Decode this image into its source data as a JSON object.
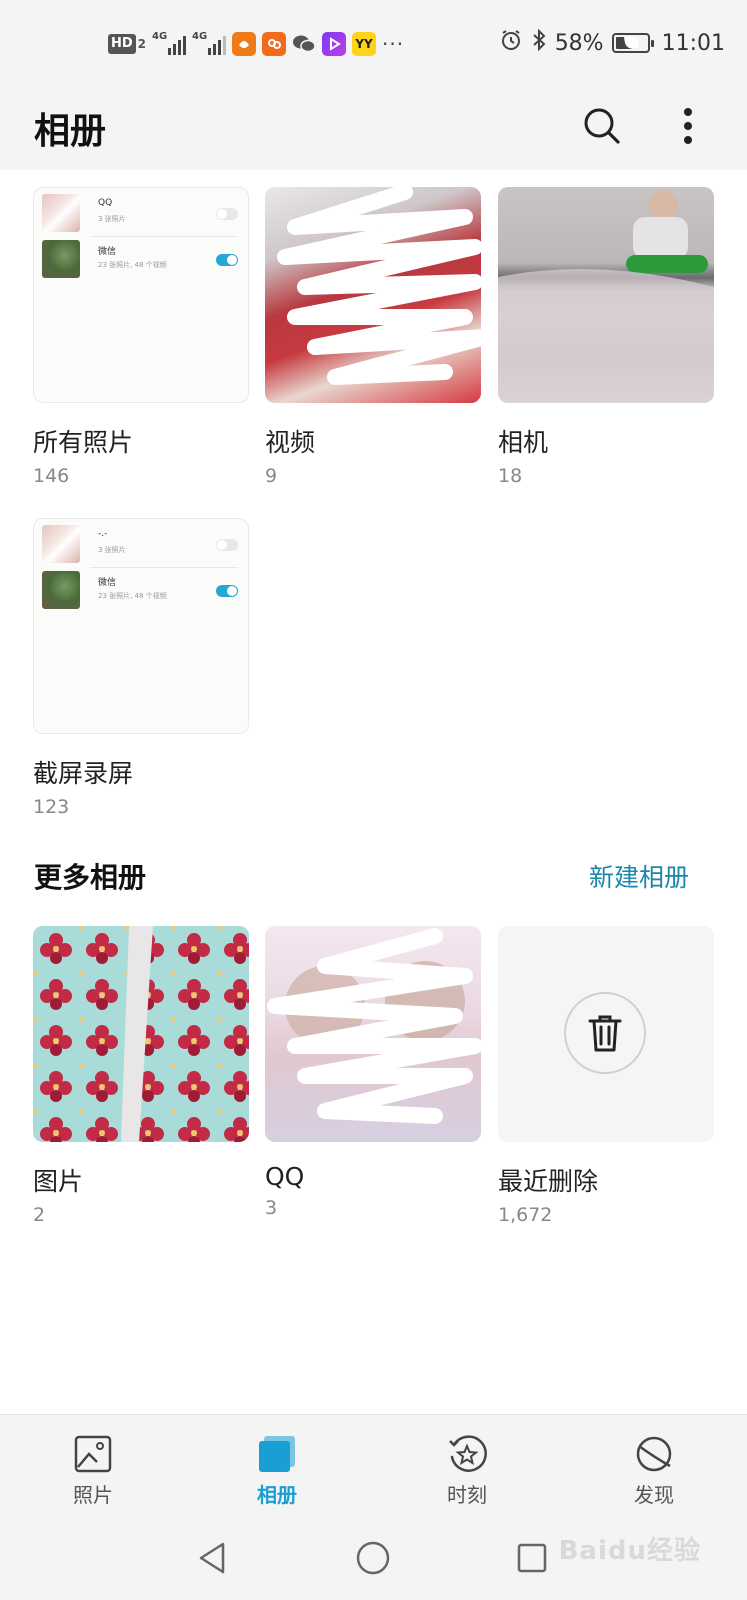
{
  "status_bar": {
    "hd_label": "HD",
    "hd_sub": "2",
    "sim1_net": "4G",
    "sim2_net": "4G",
    "yy_label": "YY",
    "more": "···",
    "battery": "58%",
    "battery_level": 0.58,
    "time": "11:01"
  },
  "header": {
    "title": "相册"
  },
  "albums": [
    {
      "name": "所有照片",
      "count": "146"
    },
    {
      "name": "视频",
      "count": "9"
    },
    {
      "name": "相机",
      "count": "18"
    },
    {
      "name": "截屏录屏",
      "count": "123"
    }
  ],
  "shot_thumb_a": {
    "row1_title": "QQ",
    "row1_sub": "3 张照片",
    "row2_title": "微信",
    "row2_sub": "23 张照片, 48 个视频"
  },
  "shot_thumb_b": {
    "row1_title": "-.-",
    "row1_sub": "3 张照片",
    "row2_title": "微信",
    "row2_sub": "23 张照片, 48 个视频"
  },
  "more_albums": {
    "title": "更多相册",
    "new_album": "新建相册",
    "items": [
      {
        "name": "图片",
        "count": "2"
      },
      {
        "name": "QQ",
        "count": "3"
      },
      {
        "name": "最近删除",
        "count": "1,672"
      }
    ]
  },
  "bottom_nav": [
    {
      "label": "照片"
    },
    {
      "label": "相册"
    },
    {
      "label": "时刻"
    },
    {
      "label": "发现"
    }
  ],
  "watermark": "Baidu经验",
  "colors": {
    "accent": "#1a9fd4",
    "link": "#1a87a8",
    "toggle_on": "#27a7d6"
  }
}
